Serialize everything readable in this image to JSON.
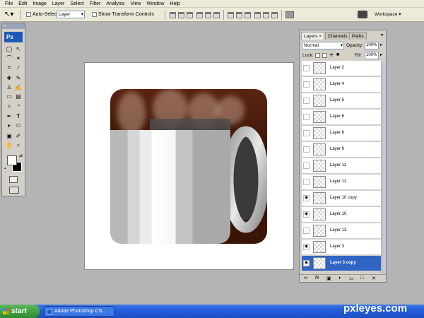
{
  "menubar": {
    "items": [
      "File",
      "Edit",
      "Image",
      "Layer",
      "Select",
      "Filter",
      "Analysis",
      "View",
      "Window",
      "Help"
    ]
  },
  "options": {
    "auto_select_label": "Auto-Select:",
    "auto_select_value": "Layer",
    "transform_label": "Show Transform Controls",
    "workspace_label": "Workspace ▾"
  },
  "toolbox": {
    "logo": "Ps",
    "collapse": "«"
  },
  "panel": {
    "tabs": [
      "Layers",
      "Channels",
      "Paths"
    ],
    "blend_mode": "Normal",
    "opacity_label": "Opacity:",
    "opacity_value": "100%",
    "lock_label": "Lock:",
    "fill_label": "Fill:",
    "fill_value": "100%",
    "layers": [
      {
        "name": "Layer 2",
        "visible": false,
        "selected": false
      },
      {
        "name": "Layer 4",
        "visible": false,
        "selected": false
      },
      {
        "name": "Layer 5",
        "visible": false,
        "selected": false
      },
      {
        "name": "Layer 6",
        "visible": false,
        "selected": false
      },
      {
        "name": "Layer 8",
        "visible": false,
        "selected": false
      },
      {
        "name": "Layer 9",
        "visible": false,
        "selected": false
      },
      {
        "name": "Layer 11",
        "visible": false,
        "selected": false
      },
      {
        "name": "Layer 12",
        "visible": false,
        "selected": false
      },
      {
        "name": "Layer 10 copy",
        "visible": true,
        "selected": false
      },
      {
        "name": "Layer 10",
        "visible": true,
        "selected": false
      },
      {
        "name": "Layer 13",
        "visible": false,
        "selected": false
      },
      {
        "name": "Layer 3",
        "visible": true,
        "selected": false
      },
      {
        "name": "Layer 3 copy",
        "visible": true,
        "selected": true
      }
    ]
  },
  "taskbar": {
    "start_label": "start",
    "task_label": "Adobe Photoshop CS..."
  },
  "watermark": "pxleyes.com",
  "colors": {
    "selection": "#3165c4",
    "coffee_bg": "#3c1606",
    "taskbar": "#245edb"
  }
}
